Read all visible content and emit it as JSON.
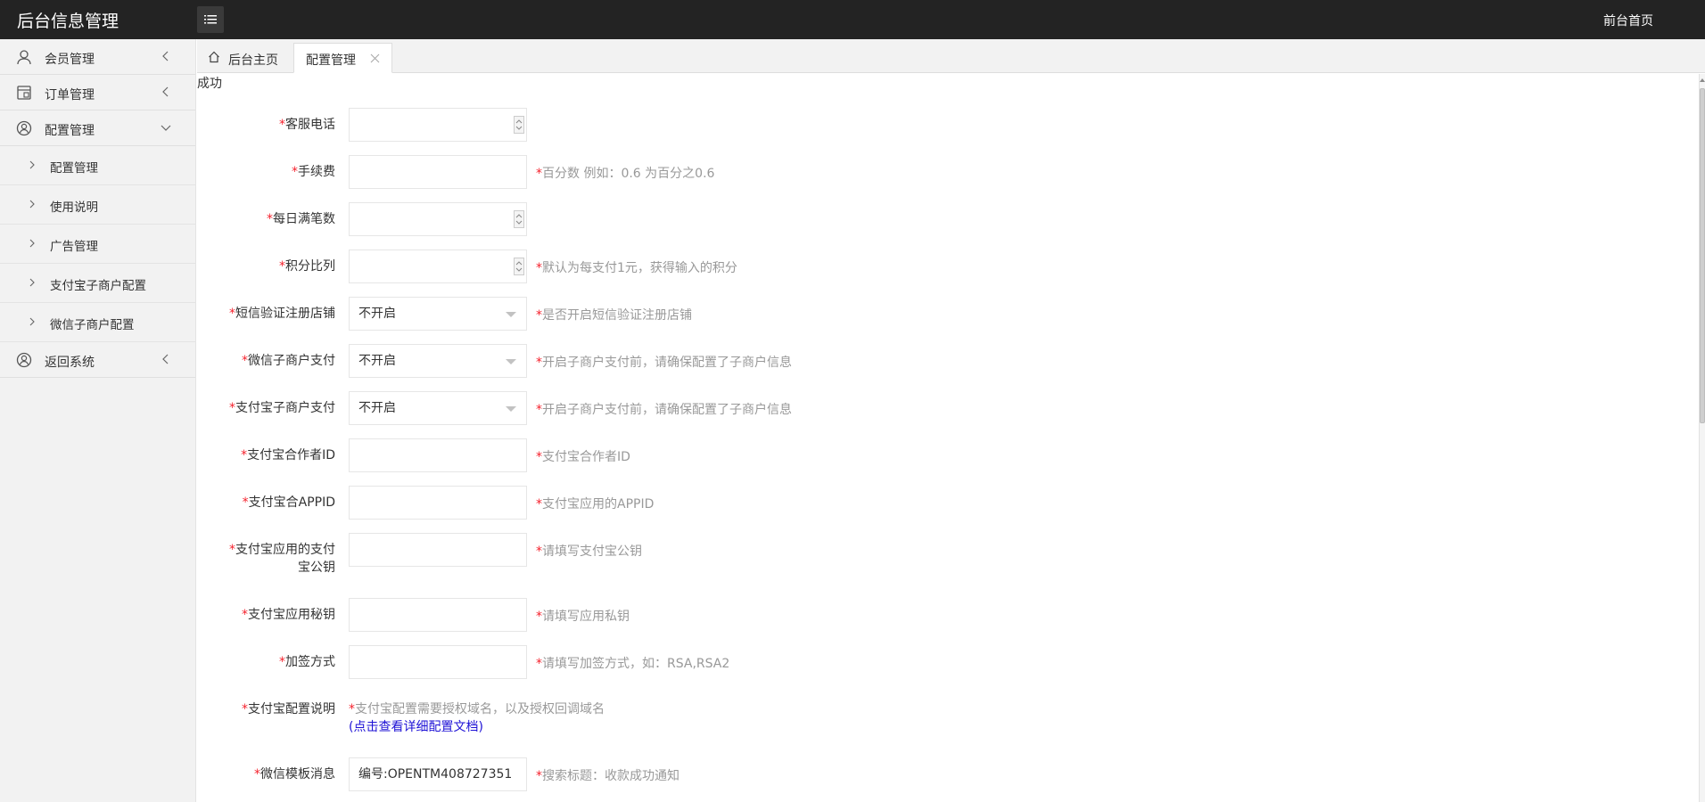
{
  "header": {
    "brand": "后台信息管理",
    "front_home": "前台首页",
    "menu_icon": "menu-list-icon"
  },
  "sidebar": {
    "items": [
      {
        "label": "会员管理",
        "icon": "user-icon",
        "arrow": "chevron-left-icon"
      },
      {
        "label": "订单管理",
        "icon": "order-icon",
        "arrow": "chevron-left-icon"
      },
      {
        "label": "配置管理",
        "icon": "user-circle-icon",
        "arrow": "chevron-down-icon"
      },
      {
        "label": "返回系统",
        "icon": "user-circle-icon",
        "arrow": "chevron-left-icon"
      }
    ],
    "sub_items": [
      {
        "label": "配置管理"
      },
      {
        "label": "使用说明"
      },
      {
        "label": "广告管理"
      },
      {
        "label": "支付宝子商户配置"
      },
      {
        "label": "微信子商户配置"
      }
    ]
  },
  "tabs": {
    "home": "后台主页",
    "active": "配置管理"
  },
  "content": {
    "status": "成功",
    "required_mark": "*",
    "fields": {
      "service_phone": {
        "label": "客服电话",
        "value": ""
      },
      "fee": {
        "label": "手续费",
        "value": "",
        "hint": "百分数 例如：0.6 为百分之0.6"
      },
      "daily_full": {
        "label": "每日满笔数",
        "value": ""
      },
      "points_ratio": {
        "label": "积分比列",
        "value": "",
        "hint": "默认为每支付1元，获得输入的积分"
      },
      "sms_verify": {
        "label": "短信验证注册店铺",
        "value": "不开启",
        "hint": "是否开启短信验证注册店铺"
      },
      "wechat_sub": {
        "label": "微信子商户支付",
        "value": "不开启",
        "hint": "开启子商户支付前，请确保配置了子商户信息"
      },
      "alipay_sub": {
        "label": "支付宝子商户支付",
        "value": "不开启",
        "hint": "开启子商户支付前，请确保配置了子商户信息"
      },
      "alipay_partner": {
        "label": "支付宝合作者ID",
        "value": "",
        "hint": "支付宝合作者ID"
      },
      "alipay_appid": {
        "label": "支付宝合APPID",
        "value": "",
        "hint": "支付宝应用的APPID"
      },
      "alipay_pubkey": {
        "label_line1": "支付宝应用的支付",
        "label_line2": "宝公钥",
        "value": "",
        "hint": "请填写支付宝公钥"
      },
      "alipay_privkey": {
        "label": "支付宝应用秘钥",
        "value": "",
        "hint": "请填写应用私钥"
      },
      "sign_type": {
        "label": "加签方式",
        "value": "",
        "hint": "请填写加签方式，如：RSA,RSA2"
      },
      "alipay_desc": {
        "label": "支付宝配置说明",
        "text": "支付宝配置需要授权域名，以及授权回调域名",
        "link": "(点击查看详细配置文档)"
      },
      "wechat_template": {
        "label": "微信模板消息",
        "value": "编号:OPENTM408727351",
        "hint": "搜索标题：收款成功通知"
      }
    }
  }
}
